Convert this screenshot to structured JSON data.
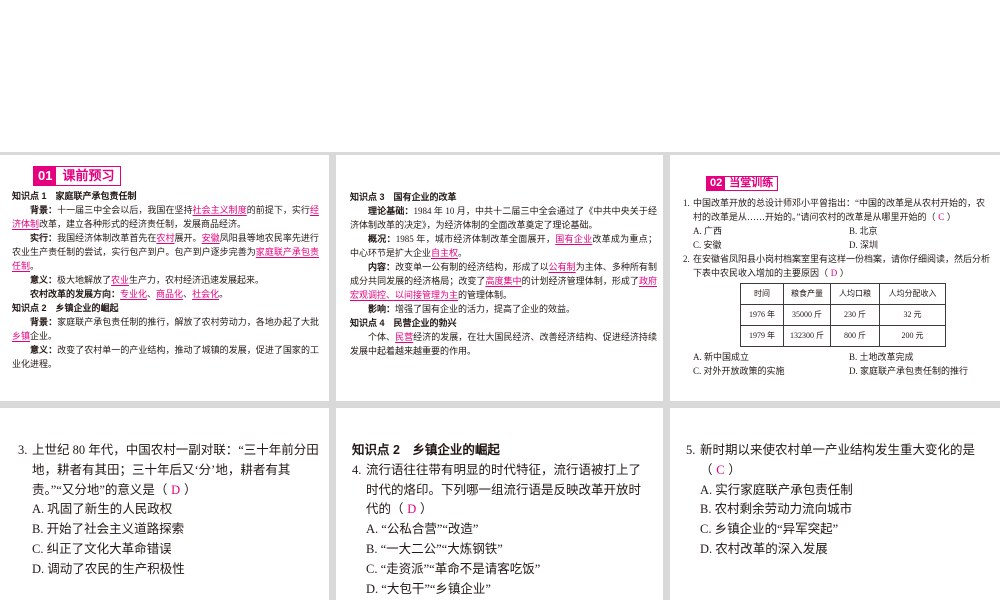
{
  "colors": {
    "accent": "#e4007f",
    "gap": "#d9d9d9"
  },
  "preview": {
    "badge_num": "01",
    "badge_title": "课前预习",
    "paragraphs": [
      {
        "kind": "heading",
        "segs": [
          {
            "t": "知识点 1　家庭联产承包责任制"
          }
        ]
      },
      {
        "kind": "body",
        "segs": [
          {
            "t": "背景：",
            "em": "label"
          },
          {
            "t": "十一届三中全会以后，我国在坚持"
          },
          {
            "t": "社会主义制度",
            "em": "key"
          },
          {
            "t": "的前提下，实行"
          },
          {
            "t": "经济体制",
            "em": "key"
          },
          {
            "t": "改革，建立各种形式的经济责任制，发展商品经济。"
          }
        ]
      },
      {
        "kind": "body",
        "segs": [
          {
            "t": "实行：",
            "em": "label"
          },
          {
            "t": "我国经济体制改革首先在"
          },
          {
            "t": "农村",
            "em": "key"
          },
          {
            "t": "展开。"
          },
          {
            "t": "安徽",
            "em": "key"
          },
          {
            "t": "凤阳县等地农民率先进行农业生产责任制的尝试，实行包产到户。包产到户逐步完善为"
          },
          {
            "t": "家庭联产承包责任制",
            "em": "key"
          },
          {
            "t": "。"
          }
        ]
      },
      {
        "kind": "body",
        "segs": [
          {
            "t": "意义：",
            "em": "label"
          },
          {
            "t": "极大地解放了"
          },
          {
            "t": "农业",
            "em": "key"
          },
          {
            "t": "生产力，农村经济迅速发展起来。"
          }
        ]
      },
      {
        "kind": "body",
        "segs": [
          {
            "t": "农村改革的发展方向：",
            "em": "label"
          },
          {
            "t": "专业化",
            "em": "key"
          },
          {
            "t": "、"
          },
          {
            "t": "商品化",
            "em": "key"
          },
          {
            "t": "、"
          },
          {
            "t": "社会化",
            "em": "key"
          },
          {
            "t": "。"
          }
        ]
      },
      {
        "kind": "heading",
        "segs": [
          {
            "t": "知识点 2　乡镇企业的崛起"
          }
        ]
      },
      {
        "kind": "body",
        "segs": [
          {
            "t": "背景：",
            "em": "label"
          },
          {
            "t": "家庭联产承包责任制的推行，解放了农村劳动力，各地办起了大批"
          },
          {
            "t": "乡镇",
            "em": "key"
          },
          {
            "t": "企业。"
          }
        ]
      },
      {
        "kind": "body",
        "segs": [
          {
            "t": "意义：",
            "em": "label"
          },
          {
            "t": "改变了农村单一的产业结构，推动了城镇的发展，促进了国家的工业化进程。"
          }
        ]
      }
    ]
  },
  "reform": {
    "paragraphs": [
      {
        "kind": "heading",
        "segs": [
          {
            "t": "知识点 3　国有企业的改革"
          }
        ]
      },
      {
        "kind": "body",
        "segs": [
          {
            "t": "理论基础：",
            "em": "label"
          },
          {
            "t": "1984 年 10 月，中共十二届三中全会通过了《中共中央关于经济体制改革的决定》，为经济体制的全面改革奠定了理论基础。"
          }
        ]
      },
      {
        "kind": "body",
        "segs": [
          {
            "t": "概况：",
            "em": "label"
          },
          {
            "t": "1985 年，城市经济体制改革全面展开，"
          },
          {
            "t": "国有企业",
            "em": "key"
          },
          {
            "t": "改革成为重点；中心环节是扩大企业"
          },
          {
            "t": "自主权",
            "em": "key"
          },
          {
            "t": "。"
          }
        ]
      },
      {
        "kind": "body",
        "segs": [
          {
            "t": "内容：",
            "em": "label"
          },
          {
            "t": "改变单一公有制的经济结构，形成了以"
          },
          {
            "t": "公有制",
            "em": "key"
          },
          {
            "t": "为主体、多种所有制成分共同发展的经济格局；改变了"
          },
          {
            "t": "高度集中",
            "em": "key"
          },
          {
            "t": "的计划经济管理体制，形成了"
          },
          {
            "t": "政府宏观调控、以间接管理为主",
            "em": "key"
          },
          {
            "t": "的管理体制。"
          }
        ]
      },
      {
        "kind": "body",
        "segs": [
          {
            "t": "影响：",
            "em": "label"
          },
          {
            "t": "增强了国有企业的活力，提高了企业的效益。"
          }
        ]
      },
      {
        "kind": "heading",
        "segs": [
          {
            "t": "知识点 4　民营企业的勃兴"
          }
        ]
      },
      {
        "kind": "body",
        "segs": [
          {
            "t": "个体、"
          },
          {
            "t": "民营",
            "em": "key"
          },
          {
            "t": "经济的发展，在壮大国民经济、改善经济结构、促进经济持续发展中起着越来越重要的作用。"
          }
        ]
      }
    ]
  },
  "practice": {
    "badge_num": "02",
    "badge_title": "当堂训练",
    "q1": {
      "num": "1.",
      "stem": "中国改革开放的总设计师邓小平曾指出：“中国的改革是从农村开始的，农村的改革是从……开始的。”请问农村的改革是从哪里开始的（",
      "answer": "C",
      "close": "）",
      "options": [
        "A. 广西",
        "B. 北京",
        "C. 安徽",
        "D. 深圳"
      ]
    },
    "q2": {
      "num": "2.",
      "stem": "在安徽省凤阳县小岗村档案室里有这样一份档案，请你仔细阅读，然后分析下表中农民收入增加的主要原因（",
      "answer": "D",
      "close": "）",
      "options": [
        "A. 新中国成立",
        "B. 土地改革完成",
        "C. 对外开放政策的实施",
        "D. 家庭联产承包责任制的推行"
      ]
    },
    "table": {
      "headers": [
        "时间",
        "粮食产量",
        "人均口粮",
        "人均分配收入"
      ],
      "rows": [
        [
          "1976 年",
          "35000 斤",
          "230 斤",
          "32 元"
        ],
        [
          "1979 年",
          "132300 斤",
          "800 斤",
          "200 元"
        ]
      ]
    }
  },
  "q3": {
    "num": "3.",
    "stem": "上世纪 80 年代，中国农村一副对联：“三十年前分田地，耕者有其田；三十年后又‘分’地，耕者有其责。”“又分地”的意义是（",
    "answer": "D",
    "close": "）",
    "options": [
      "A. 巩固了新生的人民政权",
      "B. 开始了社会主义道路探索",
      "C. 纠正了文化大革命错误",
      "D. 调动了农民的生产积极性"
    ]
  },
  "q4": {
    "heading": "知识点 2　乡镇企业的崛起",
    "num": "4.",
    "stem": "流行语往往带有明显的时代特征，流行语被打上了时代的烙印。下列哪一组流行语是反映改革开放时代的（",
    "answer": "D",
    "close": "）",
    "options": [
      "A. “公私合营”“改造”",
      "B. “一大二公”“大炼钢铁”",
      "C. “走资派”“革命不是请客吃饭”",
      "D. “大包干”“乡镇企业”"
    ]
  },
  "q5": {
    "num": "5.",
    "stem": "新时期以来使农村单一产业结构发生重大变化的是（",
    "answer": "C",
    "close": "）",
    "options": [
      "A. 实行家庭联产承包责任制",
      "B. 农村剩余劳动力流向城市",
      "C. 乡镇企业的“异军突起”",
      "D. 农村改革的深入发展"
    ]
  }
}
